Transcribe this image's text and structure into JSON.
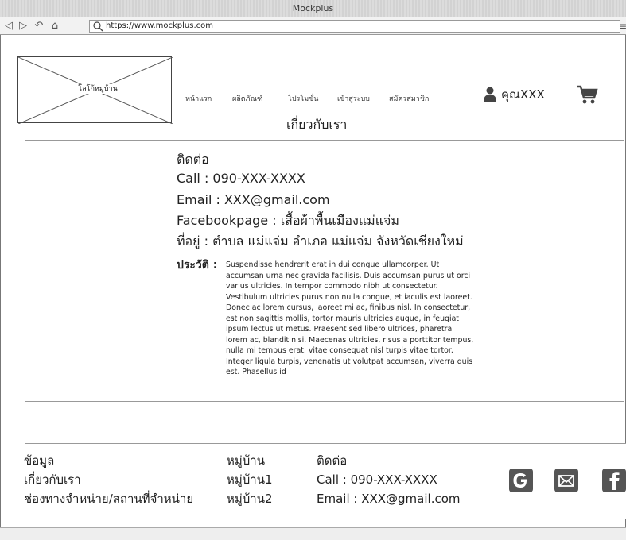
{
  "window": {
    "title": "Mockplus"
  },
  "browser": {
    "url": "https://www.mockplus.com"
  },
  "header": {
    "logo_label": "โลโก้หมู่บ้าน",
    "nav": [
      "หน้าแรก",
      "ผลิตภัณฑ์",
      "โปรโมชั่น",
      "เข้าสู่ระบบ",
      "สมัครสมาชิก"
    ],
    "user_label": "คุณXXX"
  },
  "page": {
    "title": "เกี่ยวกับเรา"
  },
  "contact": {
    "heading": "ติดต่อ",
    "call": "Call : 090-XXX-XXXX",
    "email": "Email : XXX@gmail.com",
    "facebook": "Facebookpage : เสื้อผ้าพื้นเมืองแม่แจ่ม",
    "address": "ที่อยู่ : ตำบล แม่แจ่ม อำเภอ แม่แจ่ม จังหวัดเชียงใหม่",
    "history_label": "ประวัติ :",
    "history_text": "Suspendisse hendrerit erat in dui congue ullamcorper. Ut accumsan urna nec gravida facilisis. Duis accumsan purus ut orci varius ultricies. In tempor commodo nibh ut consectetur. Vestibulum ultricies purus non nulla congue, et iaculis est laoreet. Donec ac lorem cursus, laoreet mi ac, finibus nisl. In consectetur, est non sagittis mollis, tortor mauris ultricies augue, in feugiat ipsum lectus ut metus. Praesent sed libero ultrices, pharetra lorem ac, blandit nisi. Maecenas ultricies, risus a porttitor tempus, nulla mi tempus erat, vitae consequat nisl turpis vitae tortor. Integer ligula turpis, venenatis ut volutpat accumsan, viverra quis est. Phasellus id"
  },
  "footer": {
    "col1": [
      "ข้อมูล",
      "เกี่ยวกับเรา",
      "ช่องทางจำหน่าย/สถานที่จำหน่าย"
    ],
    "col2": [
      "หมู่บ้าน",
      "หมู่บ้าน1",
      "หมู่บ้าน2"
    ],
    "col3": [
      "ติดต่อ",
      "Call : 090-XXX-XXXX",
      "Email : XXX@gmail.com"
    ],
    "social_icons": [
      "google-icon",
      "mail-icon",
      "facebook-icon"
    ]
  },
  "colors": {
    "icon_dark": "#555555",
    "border": "#999999"
  }
}
